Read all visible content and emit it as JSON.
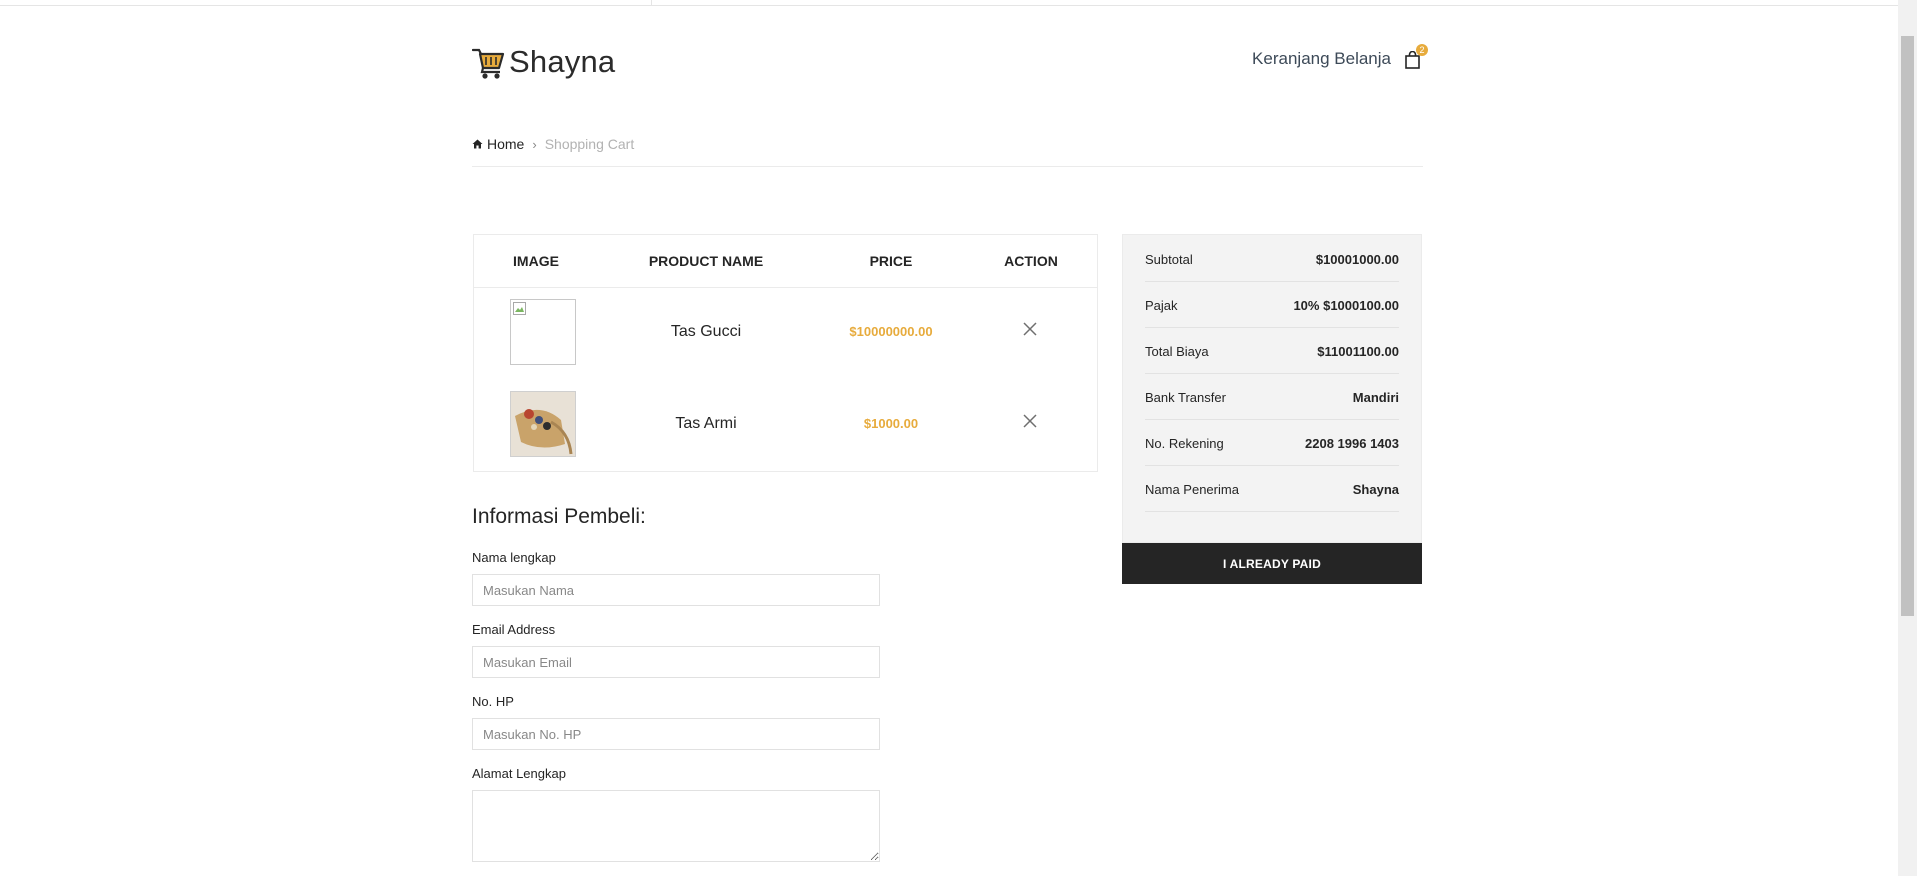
{
  "brand": {
    "name": "Shayna",
    "accent_color": "#e7ab3c",
    "logo_icon": "shopping-cart-icon"
  },
  "header": {
    "cart_label": "Keranjang Belanja",
    "cart_count": "2",
    "cart_icon": "shopping-bag-icon"
  },
  "breadcrumb": {
    "home": "Home",
    "current": "Shopping Cart"
  },
  "cart_table": {
    "headers": {
      "image": "IMAGE",
      "name": "PRODUCT NAME",
      "price": "PRICE",
      "action": "ACTION"
    },
    "items": [
      {
        "name": "Tas Gucci",
        "price": "$10000000.00",
        "image": "broken-image"
      },
      {
        "name": "Tas Armi",
        "price": "$1000.00",
        "image": "bag-photo"
      }
    ]
  },
  "buyer_form": {
    "title": "Informasi Pembeli:",
    "name": {
      "label": "Nama lengkap",
      "placeholder": "Masukan Nama",
      "value": ""
    },
    "email": {
      "label": "Email Address",
      "placeholder": "Masukan Email",
      "value": ""
    },
    "phone": {
      "label": "No. HP",
      "placeholder": "Masukan No. HP",
      "value": ""
    },
    "address": {
      "label": "Alamat Lengkap",
      "value": ""
    }
  },
  "summary": {
    "rows": [
      {
        "label": "Subtotal",
        "value": "$10001000.00"
      },
      {
        "label": "Pajak",
        "value": "10% $1000100.00"
      },
      {
        "label": "Total Biaya",
        "value": "$11001100.00"
      },
      {
        "label": "Bank Transfer",
        "value": "Mandiri"
      },
      {
        "label": "No. Rekening",
        "value": "2208 1996 1403"
      },
      {
        "label": "Nama Penerima",
        "value": "Shayna"
      }
    ],
    "button_label": "I ALREADY PAID"
  }
}
